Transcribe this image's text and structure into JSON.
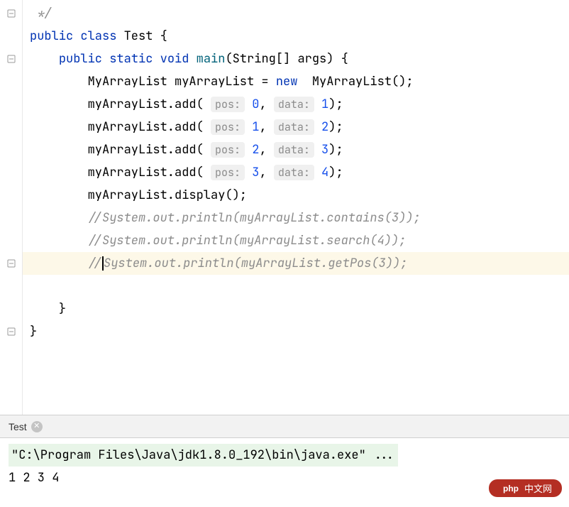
{
  "editor": {
    "line1": " */",
    "class_decl": {
      "kw_public": "public",
      "kw_class": "class",
      "name": "Test",
      "brace": " {"
    },
    "main_decl": {
      "kw_public": "public",
      "kw_static": "static",
      "kw_void": "void",
      "name": "main",
      "params": "(String[] args) {"
    },
    "line4": {
      "type1": "MyArrayList",
      "var": " myArrayList = ",
      "kw_new": "new",
      "type2": "  MyArrayList();"
    },
    "add1": {
      "prefix": "myArrayList.add( ",
      "h1": "pos:",
      "v1": " 0",
      "sep": ", ",
      "h2": "data:",
      "v2": " 1",
      "suffix": ");"
    },
    "add2": {
      "prefix": "myArrayList.add( ",
      "h1": "pos:",
      "v1": " 1",
      "sep": ", ",
      "h2": "data:",
      "v2": " 2",
      "suffix": ");"
    },
    "add3": {
      "prefix": "myArrayList.add( ",
      "h1": "pos:",
      "v1": " 2",
      "sep": ", ",
      "h2": "data:",
      "v2": " 3",
      "suffix": ");"
    },
    "add4": {
      "prefix": "myArrayList.add( ",
      "h1": "pos:",
      "v1": " 3",
      "sep": ", ",
      "h2": "data:",
      "v2": " 4",
      "suffix": ");"
    },
    "display": "myArrayList.display();",
    "comment1": "//System.out.println(myArrayList.contains(3));",
    "comment2": "//System.out.println(myArrayList.search(4));",
    "comment3_a": "//",
    "comment3_b": "System.out.println(myArrayList.getPos(3));",
    "close_method": "}",
    "close_class": "}"
  },
  "run": {
    "tab_label": "Test",
    "command": "\"C:\\Program Files\\Java\\jdk1.8.0_192\\bin\\java.exe\" ...",
    "output": "1 2 3 4"
  },
  "watermark": "中文网"
}
